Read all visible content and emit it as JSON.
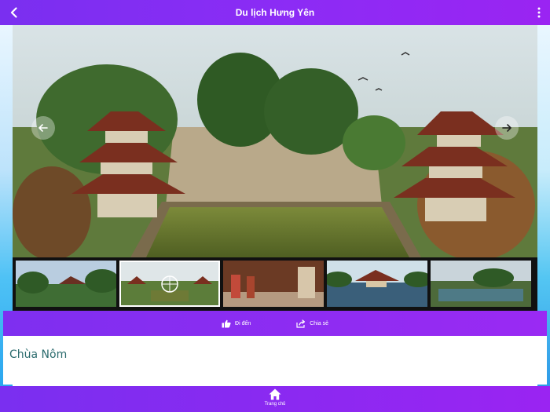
{
  "header": {
    "title": "Du lịch Hưng Yên"
  },
  "gallery": {
    "thumbnails": [
      {
        "scene": "garden-pagoda"
      },
      {
        "scene": "temple-courtyard-selected"
      },
      {
        "scene": "temple-interior"
      },
      {
        "scene": "lake-pavilion"
      },
      {
        "scene": "lake-park"
      }
    ],
    "selected_index": 1
  },
  "actions": {
    "directions_label": "Đi đến",
    "share_label": "Chia sẻ"
  },
  "place": {
    "name": "Chùa Nôm"
  },
  "nav": {
    "home_label": "Trang chủ"
  },
  "colors": {
    "header": "#8b2cf5",
    "accent_text": "#2b6b6d"
  }
}
